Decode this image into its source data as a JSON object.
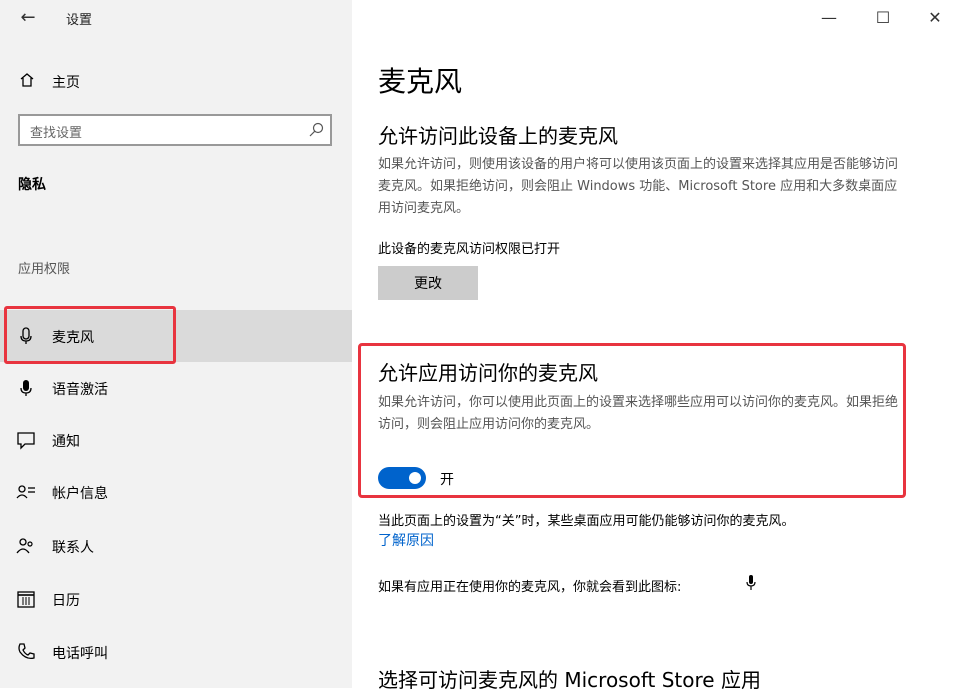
{
  "window": {
    "title": "设置",
    "controls": [
      "minimize",
      "maximize",
      "close"
    ]
  },
  "sidebar": {
    "home_label": "主页",
    "search_placeholder": "查找设置",
    "section_title": "隐私",
    "group_title": "应用权限",
    "items": [
      {
        "label": "麦克风",
        "icon": "microphone-icon",
        "selected": true
      },
      {
        "label": "语音激活",
        "icon": "voice-activation-icon",
        "selected": false
      },
      {
        "label": "通知",
        "icon": "notification-icon",
        "selected": false
      },
      {
        "label": "帐户信息",
        "icon": "account-info-icon",
        "selected": false
      },
      {
        "label": "联系人",
        "icon": "contacts-icon",
        "selected": false
      },
      {
        "label": "日历",
        "icon": "calendar-icon",
        "selected": false
      },
      {
        "label": "电话呼叫",
        "icon": "phone-icon",
        "selected": false
      }
    ]
  },
  "main": {
    "title": "麦克风",
    "device_section": {
      "heading": "允许访问此设备上的麦克风",
      "description": "如果允许访问，则使用该设备的用户将可以使用该页面上的设置来选择其应用是否能够访问麦克风。如果拒绝访问，则会阻止 Windows 功能、Microsoft Store 应用和大多数桌面应用访问麦克风。",
      "status": "此设备的麦克风访问权限已打开",
      "change_button": "更改"
    },
    "app_section": {
      "heading": "允许应用访问你的麦克风",
      "description": "如果允许访问，你可以使用此页面上的设置来选择哪些应用可以访问你的麦克风。如果拒绝访问，则会阻止应用访问你的麦克风。",
      "toggle_state": "开",
      "toggle_on": true
    },
    "note": "当此页面上的设置为“关”时，某些桌面应用可能仍能够访问你的麦克风。",
    "learn_more": "了解原因",
    "icon_note": "如果有应用正在使用你的麦克风，你就会看到此图标:",
    "store_heading": "选择可访问麦克风的 Microsoft Store 应用"
  },
  "colors": {
    "accent": "#0063cc",
    "highlight": "#e8343f",
    "sidebar_bg": "#f2f2f2",
    "selected_bg": "#dadada"
  }
}
